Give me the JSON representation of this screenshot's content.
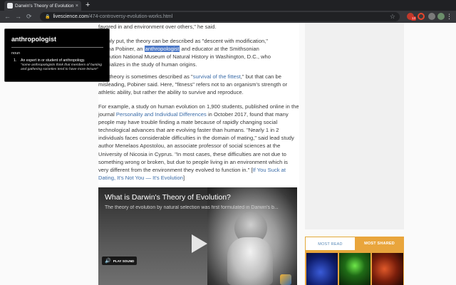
{
  "browser": {
    "tab_title": "Darwin's Theory of Evolution: De",
    "tab_close": "×",
    "new_tab": "+",
    "back": "←",
    "forward": "→",
    "reload": "⟳",
    "lock": "🔒",
    "url_host": "livescience.com",
    "url_path": "/474-controversy-evolution-works.html",
    "star": "☆",
    "extension_badge": "13",
    "menu": "⋮"
  },
  "article": {
    "p0": "favored in and environment over others,\" he said.",
    "p1_lines": [
      "Simply put, the theory can be described as \"descent with modification,\"",
      "Briana Pobiner, an",
      "and educator at the Smithsonian",
      "Institution National Museum of Natural History in Washington, D.C., who",
      "specializes in the study of human origins."
    ],
    "p1_highlight": "anthropologist",
    "p2_a": "The theory is sometimes described as \"",
    "p2_link": "survival of the fittest",
    "p2_b": ",\" but that can be misleading, Pobiner said. Here, \"fitness\" refers not to an organism's strength or athletic ability, but rather the ability to survive and reproduce.",
    "p3_a": "For example, a study on human evolution on 1,900 students, published online in the journal ",
    "p3_link1": "Personality and Individual Differences",
    "p3_b": " in October 2017, found that many people may have trouble finding a mate because of rapidly changing social technological advances that are evolving faster than humans. \"Nearly 1 in 2 individuals faces considerable difficulties in the domain of mating,\" said lead study author Menelaos Apostolou, an associate professor of social sciences at the University of Nicosia in Cyprus. \"In most cases, these difficulties are not due to something wrong or broken, but due to people living in an environment which is very different from the environment they evolved to function in.\" [",
    "p3_link2": "If You Suck at Dating, It's Not You — It's Evolution",
    "p3_c": "]"
  },
  "video": {
    "title": "What is Darwin's Theory of Evolution?",
    "subtitle": "The theory of evolution by natural selection was first formulated in Darwin's b...",
    "play_sound_label": "PLAY SOUND",
    "play_sound_icon": "🔊"
  },
  "sidebar": {
    "tab_most_read": "MOST READ",
    "tab_most_shared": "MOST SHARED"
  },
  "popup": {
    "word": "anthropologist",
    "part_of_speech": "noun",
    "number": "1.",
    "definition": "An expert in or student of anthropology.",
    "example": "\"some anthropologists think that members of hunting and gathering societies tend to have more leisure\""
  }
}
